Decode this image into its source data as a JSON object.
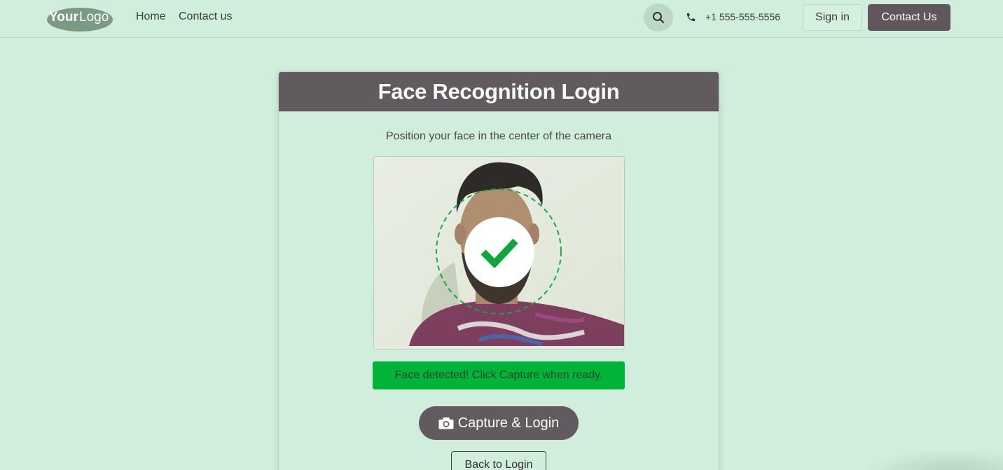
{
  "navbar": {
    "logo_text": "YourLogo",
    "links": [
      {
        "label": "Home"
      },
      {
        "label": "Contact us"
      }
    ],
    "search_icon": "search-icon",
    "phone": {
      "icon": "phone-icon",
      "number": "+1 555-555-5556"
    },
    "signin_label": "Sign in",
    "contact_label": "Contact Us"
  },
  "card": {
    "title": "Face Recognition Login",
    "instruction": "Position your face in the center of the camera",
    "camera": {
      "overlay_icon": "check-icon",
      "guide": "dashed-circle"
    },
    "status": "Face detected! Click Capture when ready.",
    "capture_label": "Capture & Login",
    "capture_icon": "camera-icon",
    "back_label": "Back to Login"
  },
  "colors": {
    "page_bg": "#d0eedb",
    "header_bg": "#615a5e",
    "accent_green": "#02b33a",
    "button_dark": "#615a5e"
  }
}
